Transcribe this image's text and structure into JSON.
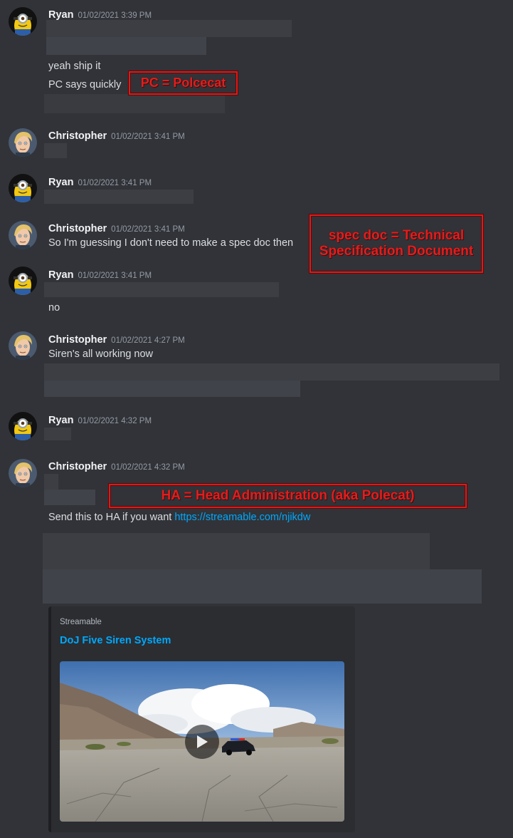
{
  "messages": [
    {
      "author": "Ryan",
      "timestamp": "01/02/2021 3:39 PM",
      "lines": [
        "yeah ship it",
        "PC says quickly"
      ]
    },
    {
      "author": "Christopher",
      "timestamp": "01/02/2021 3:41 PM"
    },
    {
      "author": "Ryan",
      "timestamp": "01/02/2021 3:41 PM"
    },
    {
      "author": "Christopher",
      "timestamp": "01/02/2021 3:41 PM",
      "lines": [
        "So I'm guessing I don't need to make a spec doc then"
      ]
    },
    {
      "author": "Ryan",
      "timestamp": "01/02/2021 3:41 PM",
      "lines": [
        "no"
      ]
    },
    {
      "author": "Christopher",
      "timestamp": "01/02/2021 4:27 PM",
      "lines": [
        "Siren's all working now"
      ]
    },
    {
      "author": "Ryan",
      "timestamp": "01/02/2021 4:32 PM"
    },
    {
      "author": "Christopher",
      "timestamp": "01/02/2021 4:32 PM",
      "lines": [
        "Send this to HA if you want "
      ],
      "link": "https://streamable.com/njikdw"
    }
  ],
  "annotations": {
    "pc": "PC = Polcecat",
    "spec_line1": "spec doc = Technical",
    "spec_line2": "Specification Document",
    "ha": "HA = Head Administration (aka Polecat)"
  },
  "embed": {
    "provider": "Streamable",
    "title": "DoJ Five Siren System"
  },
  "colors": {
    "background": "#313338",
    "link": "#00a8fc",
    "annotation": "#e01f1f",
    "embed_bg": "#2b2d31"
  }
}
